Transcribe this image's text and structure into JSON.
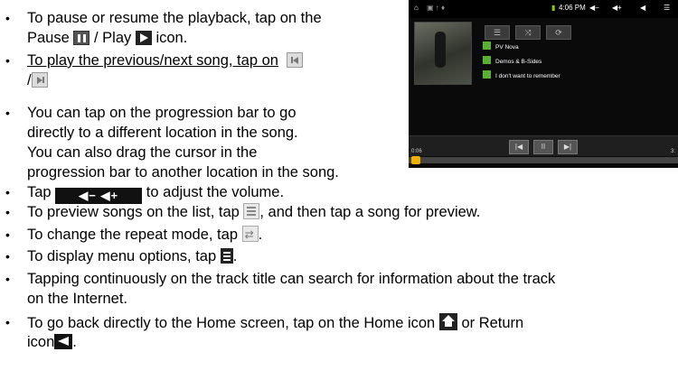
{
  "doc": {
    "l1": "To pause or resume the playback, tap on the",
    "l2a": "Pause",
    "l2b": "/ Play",
    "l2c": "icon.",
    "l3": "To play the previous/next song, tap on",
    "l4": "/",
    "l5": "You can tap on the progression bar to go",
    "l6": "directly to a different location in the song.",
    "l7": "You can also drag the cursor in the",
    "l8": "progression bar to another location in the song.",
    "l9a": "Tap",
    "l9b": "to adjust the volume.",
    "l10a": "To preview songs on the list, tap",
    "l10b": ", and then tap a song for preview.",
    "l11a": "To change the repeat mode, tap",
    "l11b": ".",
    "l12a": "To display menu options, tap",
    "l12b": ".",
    "l13": "Tapping continuously on the track title can search for information about the track",
    "l14": "on the Internet.",
    "l15a": "To go back directly to the Home screen, tap on the Home icon",
    "l15b": "or Return",
    "l16a": "icon",
    "l16b": "."
  },
  "icons": {
    "volume_label": "◀−  ◀+"
  },
  "screenshot": {
    "clock": "4:06 PM",
    "tracks": [
      "PV Nova",
      "Demos & B-Sides",
      "I don't want to remember"
    ],
    "time_elapsed": "0:06",
    "time_total": "3:"
  }
}
